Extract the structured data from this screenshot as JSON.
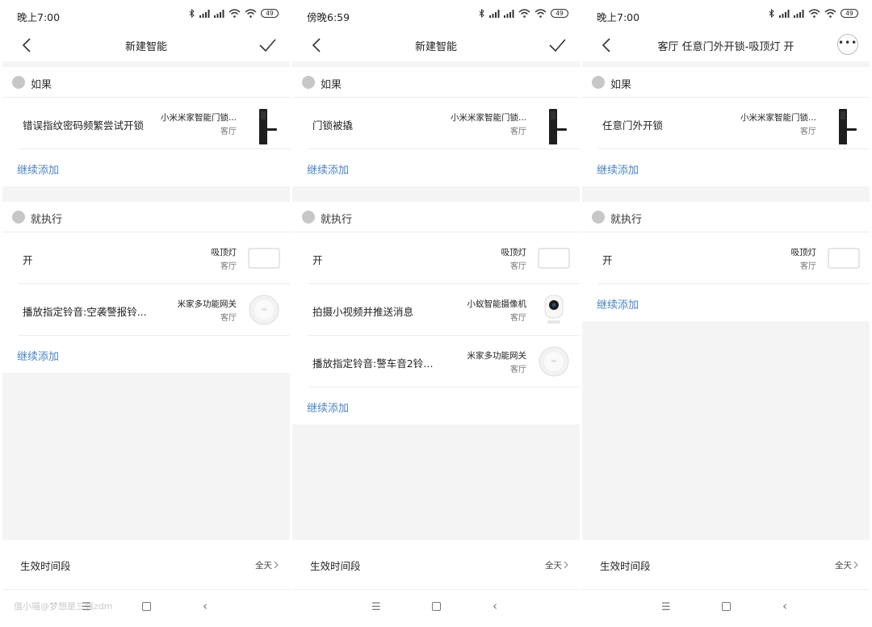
{
  "screens": [
    {
      "status_time": "晚上7:00",
      "battery": "49",
      "title": "新建智能",
      "if_label": "如果",
      "conditions": [
        {
          "label": "错误指纹密码频繁尝试开锁",
          "device": "小米米家智能门锁...",
          "room": "客厅",
          "device_icon": "door-lock"
        }
      ],
      "add_condition": "继续添加",
      "then_label": "就执行",
      "actions": [
        {
          "label": "开",
          "device": "吸顶灯",
          "room": "客厅",
          "device_icon": "ceiling-light"
        },
        {
          "label": "播放指定铃音:空袭警报铃...",
          "device": "米家多功能网关",
          "room": "客厅",
          "device_icon": "gateway"
        }
      ],
      "add_action": "继续添加",
      "footer_label": "生效时间段",
      "footer_value": "全天",
      "watermark": "值小喵@梦想是三强zdm"
    },
    {
      "status_time": "傍晚6:59",
      "battery": "49",
      "title": "新建智能",
      "if_label": "如果",
      "conditions": [
        {
          "label": "门锁被撬",
          "device": "小米米家智能门锁...",
          "room": "客厅",
          "device_icon": "door-lock"
        }
      ],
      "add_condition": "继续添加",
      "then_label": "就执行",
      "actions": [
        {
          "label": "开",
          "device": "吸顶灯",
          "room": "客厅",
          "device_icon": "ceiling-light"
        },
        {
          "label": "拍摄小视频并推送消息",
          "device": "小蚁智能摄像机",
          "room": "客厅",
          "device_icon": "camera"
        },
        {
          "label": "播放指定铃音:警车音2铃声...",
          "device": "米家多功能网关",
          "room": "客厅",
          "device_icon": "gateway"
        }
      ],
      "add_action": "继续添加",
      "footer_label": "生效时间段",
      "footer_value": "全天"
    },
    {
      "status_time": "晚上7:00",
      "battery": "49",
      "title": "客厅 任意门外开锁-吸顶灯 开",
      "if_label": "如果",
      "conditions": [
        {
          "label": "任意门外开锁",
          "device": "小米米家智能门锁...",
          "room": "客厅",
          "device_icon": "door-lock"
        }
      ],
      "add_condition": "继续添加",
      "then_label": "就执行",
      "actions": [
        {
          "label": "开",
          "device": "吸顶灯",
          "room": "客厅",
          "device_icon": "ceiling-light"
        }
      ],
      "add_action": "继续添加",
      "footer_label": "生效时间段",
      "footer_value": "全天"
    }
  ],
  "colors": {
    "link": "#4b84c4",
    "background": "#f4f4f4",
    "card": "#ffffff"
  }
}
